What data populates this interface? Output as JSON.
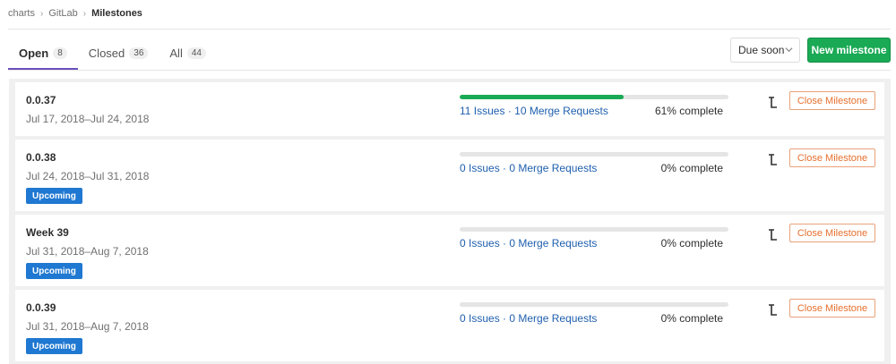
{
  "breadcrumb": {
    "items": [
      "charts",
      "GitLab"
    ],
    "current": "Milestones"
  },
  "tabs": [
    {
      "label": "Open",
      "count": "8"
    },
    {
      "label": "Closed",
      "count": "36"
    },
    {
      "label": "All",
      "count": "44"
    }
  ],
  "sort": {
    "selected": "Due soon"
  },
  "new_milestone_label": "New milestone",
  "close_label": "Close Milestone",
  "upcoming_label": "Upcoming",
  "milestones": [
    {
      "title": "0.0.37",
      "dates": "Jul 17, 2018–Jul 24, 2018",
      "issues": "11 Issues",
      "merge_requests": "10 Merge Requests",
      "complete": "61% complete",
      "progress": 0.61
    },
    {
      "title": "0.0.38",
      "dates": "Jul 24, 2018–Jul 31, 2018",
      "issues": "0 Issues",
      "merge_requests": "0 Merge Requests",
      "complete": "0% complete",
      "progress": 0
    },
    {
      "title": "Week 39",
      "dates": "Jul 31, 2018–Aug 7, 2018",
      "issues": "0 Issues",
      "merge_requests": "0 Merge Requests",
      "complete": "0% complete",
      "progress": 0
    },
    {
      "title": "0.0.39",
      "dates": "Jul 31, 2018–Aug 7, 2018",
      "issues": "0 Issues",
      "merge_requests": "0 Merge Requests",
      "complete": "0% complete",
      "progress": 0
    }
  ],
  "colors": {
    "accent": "#6b4fbb",
    "success": "#1aaa55",
    "link": "#1f5fae",
    "upcoming": "#1f78d1",
    "warning": "#e6702e"
  },
  "icons": {
    "breadcrumb_separator": "chevron-right-icon",
    "sort_dropdown": "chevron-down-icon",
    "promote": "level-up-icon"
  }
}
